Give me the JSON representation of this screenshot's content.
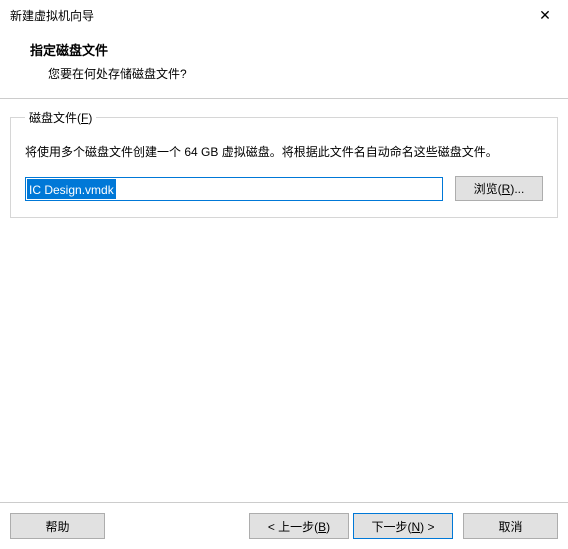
{
  "titlebar": {
    "title": "新建虚拟机向导"
  },
  "header": {
    "title": "指定磁盘文件",
    "subtitle": "您要在何处存储磁盘文件?"
  },
  "group": {
    "legend_pre": "磁盘文件(",
    "legend_key": "F",
    "legend_post": ")",
    "description": "将使用多个磁盘文件创建一个 64 GB 虚拟磁盘。将根据此文件名自动命名这些磁盘文件。",
    "file_value": "IC Design.vmdk",
    "browse_pre": "浏览(",
    "browse_key": "R",
    "browse_post": ")..."
  },
  "footer": {
    "help": "帮助",
    "back_pre": "< 上一步(",
    "back_key": "B",
    "back_post": ")",
    "next_pre": "下一步(",
    "next_key": "N",
    "next_post": ") >",
    "cancel": "取消"
  }
}
